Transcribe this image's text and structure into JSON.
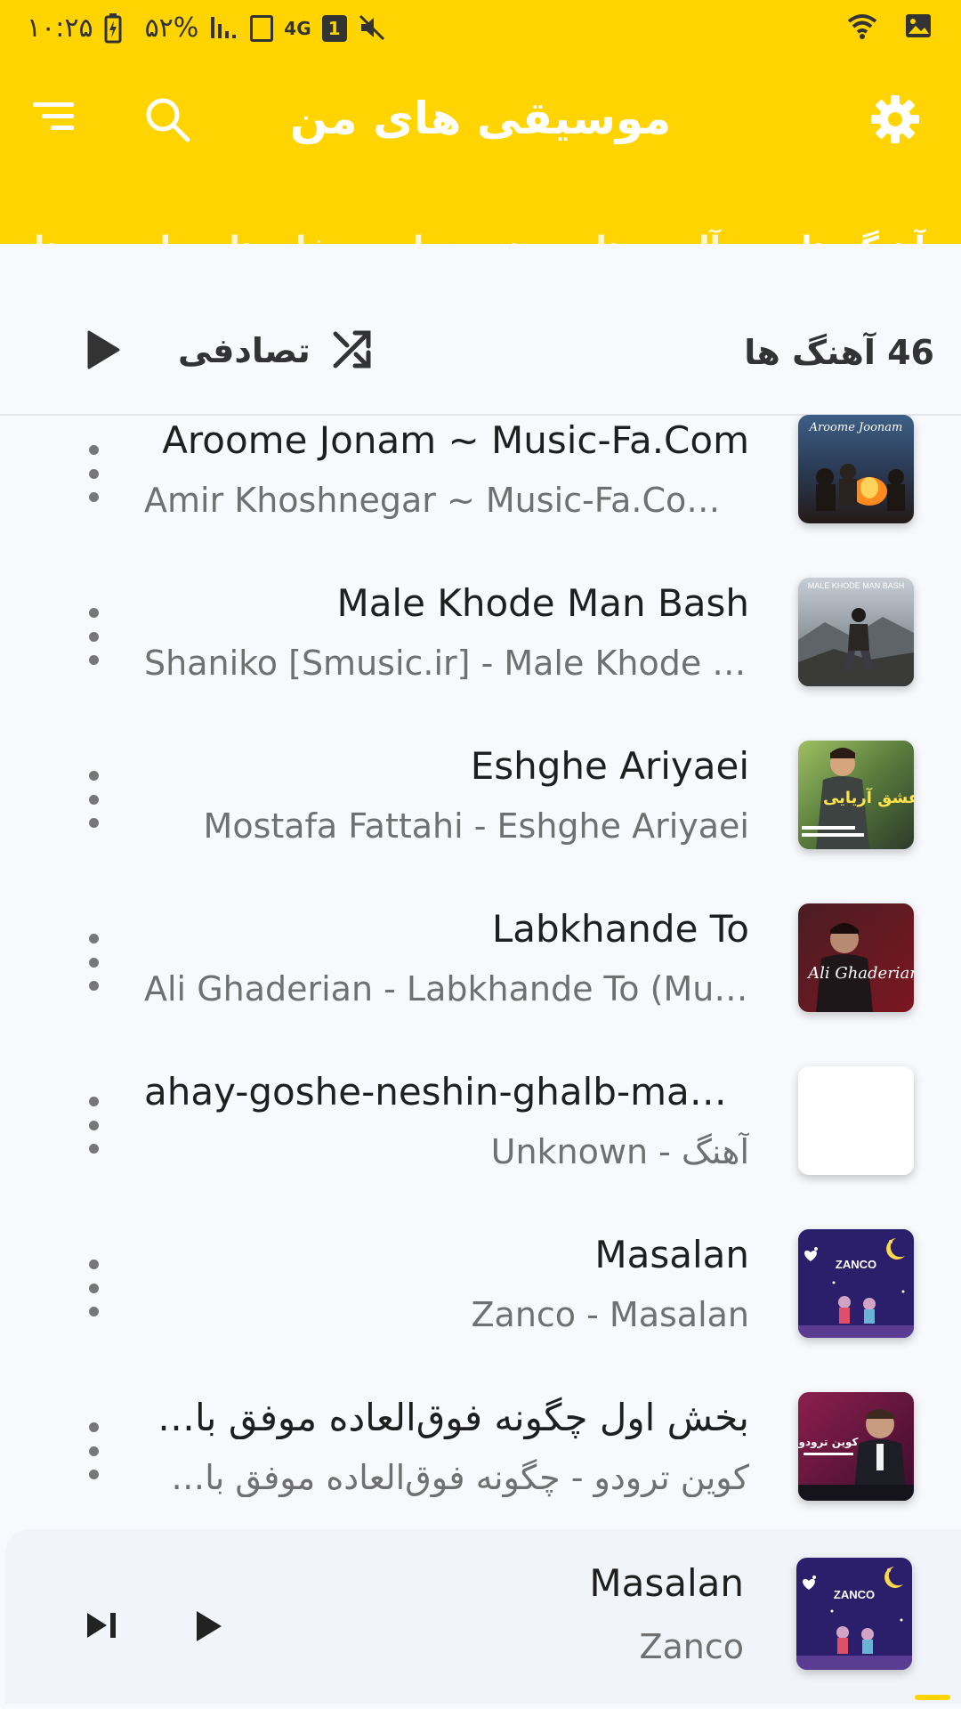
{
  "status_bar": {
    "time": "۱۰:۲۵",
    "battery": "۵۲%",
    "network": "4G",
    "sim": "1"
  },
  "app_bar": {
    "title": "موسیقی های من"
  },
  "tabs": [
    {
      "label": "آهنگ ها",
      "active": true
    },
    {
      "label": "آلبوم ها",
      "active": false
    },
    {
      "label": "هنرمندان",
      "active": false
    },
    {
      "label": "ژانرها",
      "active": false
    },
    {
      "label": "لیست های پخش",
      "active": false
    }
  ],
  "header": {
    "count_label": "46 آهنگ ها",
    "shuffle_label": "تصادفی"
  },
  "songs": [
    {
      "title": "Aroome Jonam ~ Music-Fa.Com",
      "subtitle": "Amir Khoshnegar ~ Music-Fa.Com - Aroome Jonam",
      "art_text": "Aroome Joonam",
      "art": "campfire"
    },
    {
      "title": "Male Khode Man Bash",
      "subtitle": "Shaniko [Smusic.ir] - Male Khode Man Bash",
      "art_text": "MALE KHODE MAN BASH",
      "art": "mountain"
    },
    {
      "title": "Eshghe Ariyaei",
      "subtitle": "Mostafa Fattahi - Eshghe Ariyaei",
      "art_text": "عشق آریایی",
      "art": "green"
    },
    {
      "title": "Labkhande To",
      "subtitle": "Ali Ghaderian - Labkhande To (Music-Fa)",
      "art_text": "Ali Ghaderian",
      "art": "red"
    },
    {
      "title": "ahay-goshe-neshin-ghalb-man-music-fa",
      "subtitle": "Unknown - آهنگ",
      "art_text": "",
      "art": "blank"
    },
    {
      "title": "Masalan",
      "subtitle": "Zanco - Masalan",
      "art_text": "ZANCO",
      "art": "zanco"
    },
    {
      "title": "بخش اول چگونه فوق‌العاده موفق باشیم",
      "subtitle": "کوین ترودو - چگونه فوق‌العاده موفق باشیم",
      "art_text": "کوین ترودو",
      "art": "kevin",
      "rtl": true
    }
  ],
  "player": {
    "title": "Masalan",
    "subtitle": "Zanco",
    "art_text": "ZANCO"
  },
  "colors": {
    "accent": "#ffd400",
    "background": "#f7f9fd"
  }
}
